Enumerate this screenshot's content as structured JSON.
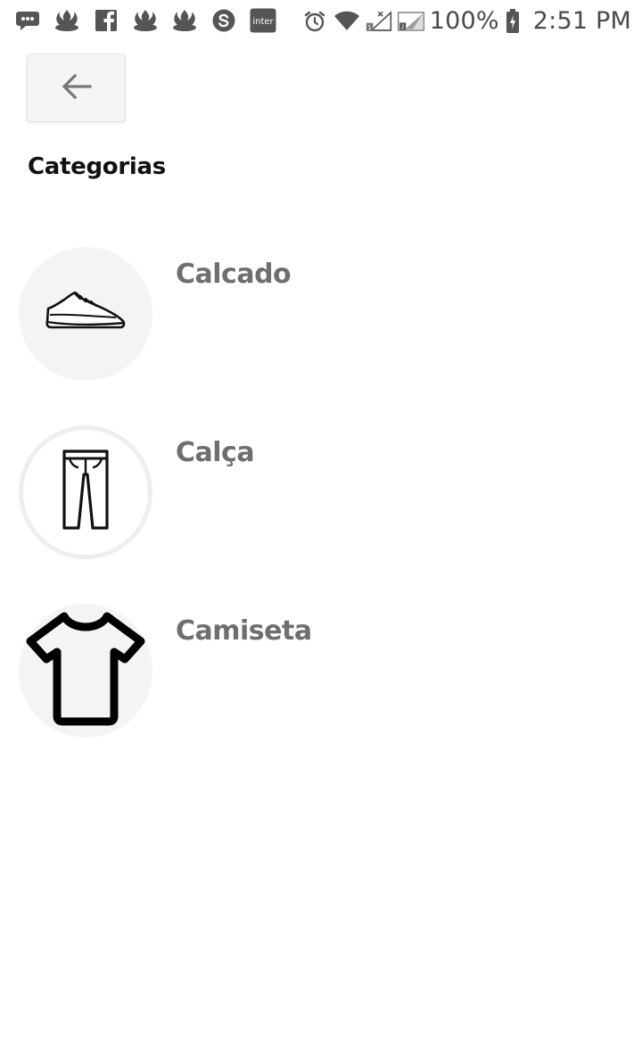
{
  "status_bar": {
    "left_icons": [
      "message-icon",
      "santander-icon",
      "facebook-icon",
      "santander-icon",
      "santander-icon",
      "skype-icon",
      "inter-icon"
    ],
    "inter_label": "inter",
    "right_icons": [
      "alarm-icon",
      "wifi-icon",
      "signal-sim1-icon",
      "signal-sim2-icon",
      "battery-charging-icon"
    ],
    "battery_percent": "100%",
    "time": "2:51 PM"
  },
  "header": {
    "back_icon": "arrow-left-icon",
    "title": "Categorias"
  },
  "categories": [
    {
      "name": "Calcado",
      "icon": "sneaker-icon"
    },
    {
      "name": "Calça",
      "icon": "pants-icon"
    },
    {
      "name": "Camiseta",
      "icon": "tshirt-icon"
    }
  ],
  "colors": {
    "title": "#111111",
    "category_text": "#6f6f6f",
    "button_bg": "#f4f5f6",
    "thumb_bg": "#f4f4f4"
  }
}
